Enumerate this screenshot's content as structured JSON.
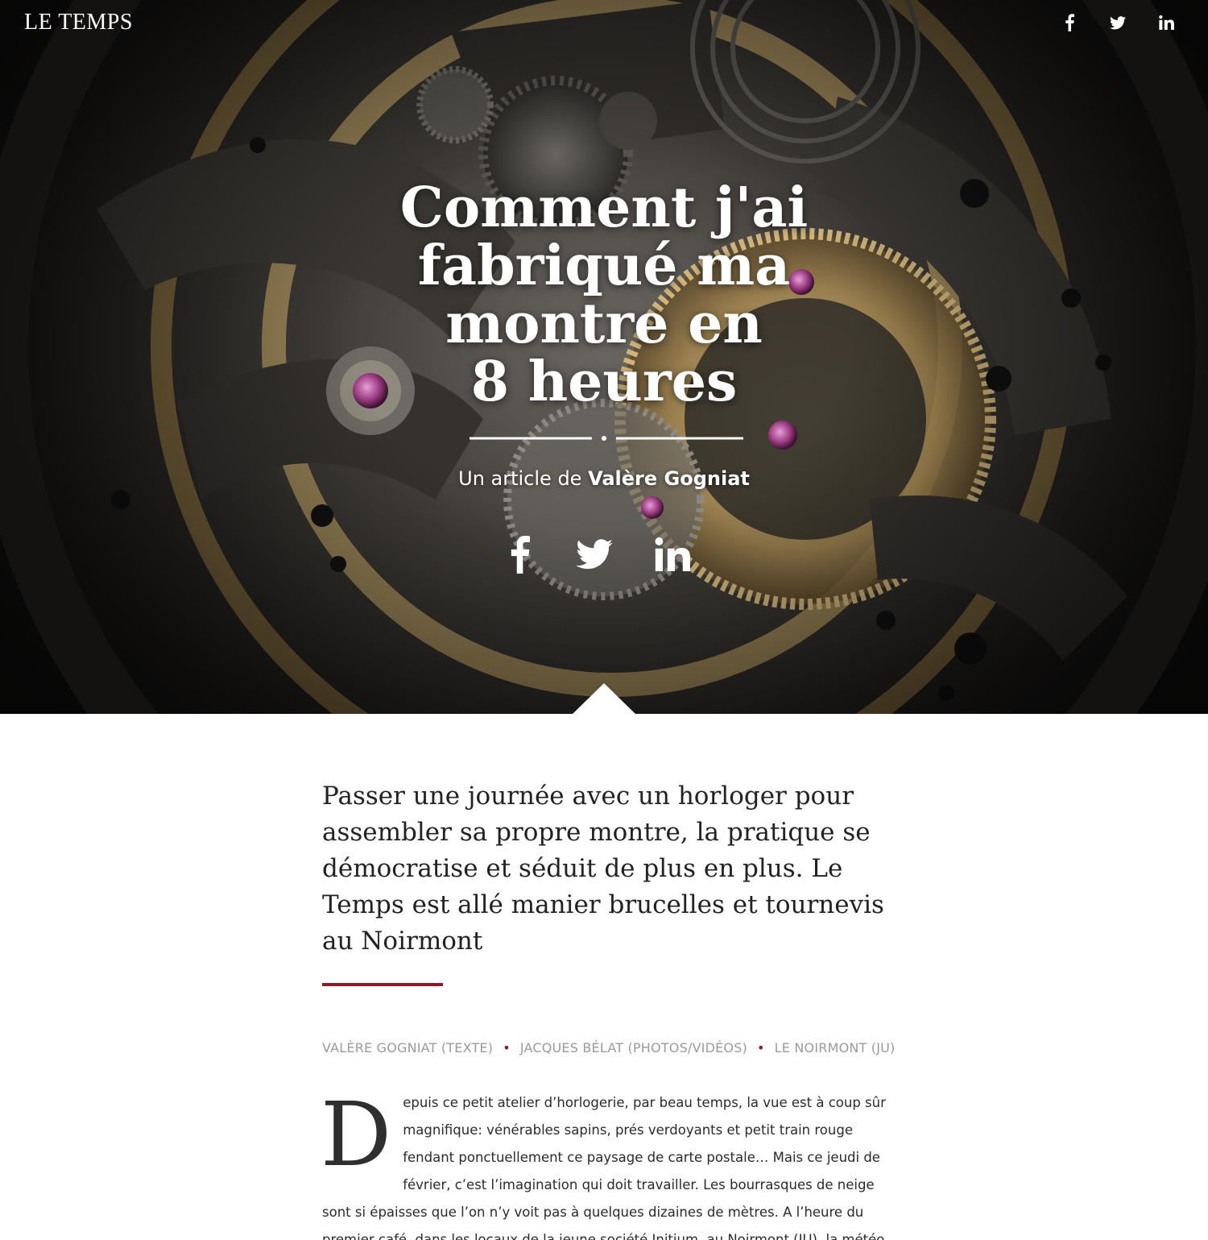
{
  "header": {
    "logo": "LE TEMPS",
    "social_icons": [
      "facebook-icon",
      "twitter-icon",
      "linkedin-icon"
    ]
  },
  "hero": {
    "title_lines": [
      "Comment j'ai",
      "fabriqué ma",
      "montre en",
      "8 heures"
    ],
    "byline_prefix": "Un article de",
    "byline_author": "Valère Gogniat",
    "social_icons": [
      "facebook-icon",
      "twitter-icon",
      "linkedin-icon"
    ]
  },
  "article": {
    "lead": "Passer une journée avec un horloger pour assembler sa propre montre, la pratique se démocratise et séduit de plus en plus. Le Temps est allé manier brucelles et tournevis au Noirmont",
    "credits": [
      "VALÈRE GOGNIAT (TEXTE)",
      "JACQUES BÉLAT (PHOTOS/VIDÉOS)",
      "LE NOIRMONT (JU)"
    ],
    "dropcap": "D",
    "body": "epuis ce petit atelier d’horlogerie, par beau temps, la vue est à coup sûr magnifique: vénérables sapins, prés verdoyants et petit train rouge fendant ponctuellement ce paysage de carte postale… Mais ce jeudi de février, c’est l’imagination qui doit travailler. Les bourrasques de neige sont si épaisses que l’on n’y voit pas à quelques dizaines de mètres. A l’heure du premier café, dans les locaux de la jeune société Initium, au Noirmont (JU), la météo du jour permet en tout cas de briser la glace."
  },
  "colors": {
    "accent": "#8b1a2b",
    "credits": "#9a9a9a"
  }
}
